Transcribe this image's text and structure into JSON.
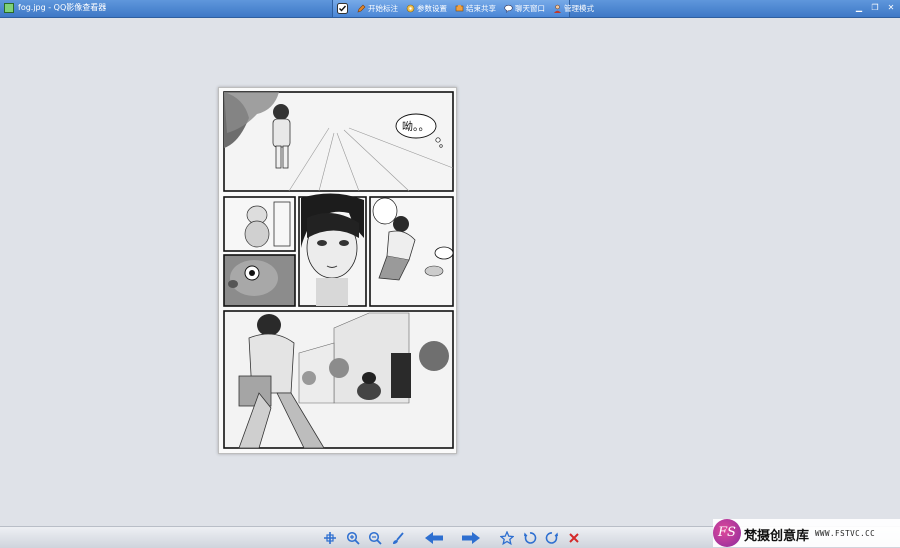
{
  "window": {
    "title": "fog.jpg - QQ影像查看器",
    "controls": [
      "minimize",
      "restore",
      "close"
    ]
  },
  "toolbar": {
    "items": [
      {
        "label": "开始标注",
        "icon": "pencil-icon",
        "color": "#e0852b"
      },
      {
        "label": "参数设置",
        "icon": "settings-icon",
        "color": "#f2c14e"
      },
      {
        "label": "结束共享",
        "icon": "share-icon",
        "color": "#f0a040"
      },
      {
        "label": "聊天窗口",
        "icon": "chat-icon",
        "color": "#ffffff"
      },
      {
        "label": "管理模式",
        "icon": "user-icon",
        "color": "#c0392b"
      }
    ]
  },
  "image": {
    "description_bubble": "呦。。"
  },
  "bottom_toolbar": {
    "buttons": [
      "fit-icon",
      "zoom-in-icon",
      "zoom-out-icon",
      "brush-icon",
      "prev-arrow-icon",
      "next-arrow-icon",
      "favorite-icon",
      "rotate-left-icon",
      "rotate-right-icon",
      "delete-icon"
    ]
  },
  "watermark": {
    "logo": "FS",
    "text": "梵摄创意库",
    "url": "WWW.FSTVC.CC"
  },
  "colors": {
    "titlebar": "#3e78c6",
    "background": "#dfe2e8",
    "accent": "#2e6fd0"
  }
}
